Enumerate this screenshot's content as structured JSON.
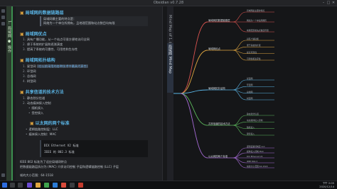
{
  "window": {
    "title": "Obsidian v0.7.28"
  },
  "doc_tab_label": "1. 局域网 ● 操作",
  "map_tab_label": "Mind Map of 1. 局域网",
  "map_tab_active_label": "局域网 Mind Map",
  "sections": [
    {
      "title": "局域网的数据链路层"
    },
    {
      "title": "局域网优点"
    },
    {
      "title": "局域网拓扑结构"
    },
    {
      "title": "共享信道的技术方法"
    },
    {
      "title": "以太网的两个标准"
    }
  ],
  "quote1": {
    "line1": "局域网最主要的特点是：",
    "line2": "网络为一个单位所拥有，且地理范围和站点数目均有限"
  },
  "advantages": [
    "具有广播功能，从一个站点可很方便地访问全网",
    "便于系统的扩展和逐渐演变",
    "提高了系统的可靠性、可用性和生存性"
  ],
  "topology": {
    "item1_text": "星型网",
    "item1_hl": "(在以前采用的各种技术中最具代表性)",
    "item2": "环型网",
    "item3": "总线网",
    "item4": "树型网"
  },
  "shared": {
    "item1": "静态划分信道",
    "item2": "动态媒体接入控制",
    "sub1": "随机接入",
    "sub2": "受控接入"
  },
  "ethernet": {
    "item1": "逻辑链路控制层：LLC",
    "item2": "媒体接入控制：MAC",
    "code1": "DIX Ethernet V2 标准",
    "code2": "IEEE 的 802.3 标准"
  },
  "footer_lines": [
    "IEEE 802 标准为了适应局域网特点",
    "把数据链路层拆分为 (MAC) 介质访问控制 子层和逻辑链路控制 (LLC) 子层"
  ],
  "footer_tail": "帧的大小范围：64-1518",
  "mindmap": {
    "branches": [
      {
        "label": "局域网的数据链路层",
        "color": "#d9534f"
      },
      {
        "label": "局域网优点",
        "color": "#e0a640"
      },
      {
        "label": "局域网拓扑结构",
        "color": "#5ab5e6"
      },
      {
        "label": "共享信道的技术方法",
        "color": "#5cb85c"
      },
      {
        "label": "以太网的两个标准",
        "color": "#a66bd6"
      }
    ],
    "leaves": [
      "局域网最主要的特点",
      "网络为一个单位所拥有",
      "地理范围和站点数目有限",
      "具有广播功能",
      "便于系统的扩展",
      "提高可靠性",
      "可用性和生存性",
      "星型网",
      "环型网",
      "总线网",
      "树型网",
      "静态划分信道",
      "动态媒体接入控制",
      "随机接入",
      "受控接入",
      "逻辑链路控制层 LLC",
      "媒体接入控制 MAC",
      "DIX Ethernet V2",
      "IEEE 802.3",
      "帧的大小范围 64-1518"
    ]
  },
  "clock": {
    "time": "下午 2:05",
    "date": "2020/12/14"
  }
}
